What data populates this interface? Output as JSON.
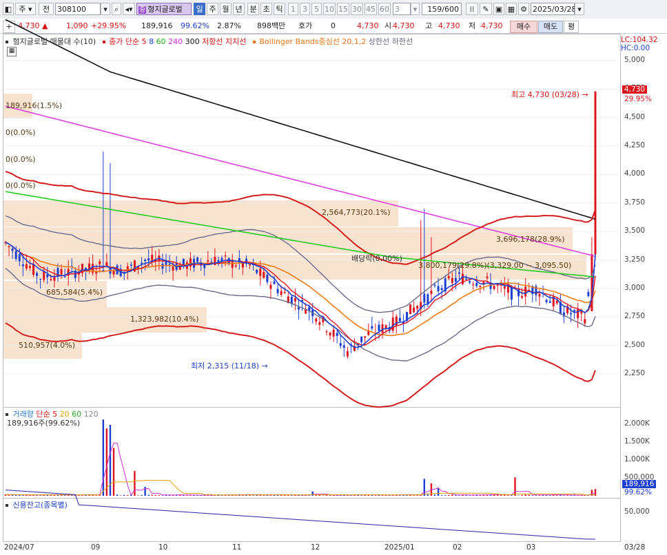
{
  "toolbar": {
    "type_label": "주",
    "range_label": "전",
    "code": "308100",
    "stock_name": "형지글로벌",
    "periods": [
      "일",
      "주",
      "월",
      "년",
      "분",
      "초",
      "틱"
    ],
    "nums": [
      "1",
      "3",
      "5",
      "10",
      "15",
      "30",
      "45",
      "60"
    ],
    "num_select": "3",
    "count": "159",
    "count_total": "/600",
    "date": "2025/03/28"
  },
  "quote": {
    "price": "4,730",
    "change": "1,090",
    "change_pct": "+29.95%",
    "volume": "189,916",
    "vol_ratio": "99.62%",
    "turnover": "2.87%",
    "amount": "898백만",
    "hoga_label": "호가",
    "hoga_val": "0",
    "hoga_price": "4,730",
    "open_label": "시",
    "open": "4,730",
    "high_label": "고",
    "high": "4,730",
    "low_label": "저",
    "low": "4,730",
    "buy": "매수",
    "sell": "매도",
    "eval": "평"
  },
  "legend": {
    "name": "형지글로벌 매물대 수(10)",
    "ma_label": "종가 단순 5",
    "ma8": "8",
    "ma60": "60",
    "ma240": "240",
    "ma300": "300",
    "resist": "저항선",
    "support": "지지선",
    "bb": "Bollinger Bands중심선 20,1,2",
    "bb_up": "상한선",
    "bb_down": "하한선"
  },
  "price_axis": {
    "lc": "LC:104.32",
    "hc": "HC:0.00",
    "ticks": [
      "5,000",
      "4,750",
      "4,500",
      "4,250",
      "4,000",
      "3,750",
      "3,500",
      "3,250",
      "3,000",
      "2,750",
      "2,500",
      "2,250"
    ],
    "last_price": "4,730",
    "last_pct": "29.95%"
  },
  "annotations": {
    "high": "최고 4,730 (03/28)",
    "low": "최저 2,315 (11/18)",
    "dividend": "배당락(0.00%)",
    "vp": [
      "189,916(1.5%)",
      "0(0.0%)",
      "0(0.0%)",
      "0(0.0%)",
      "2,564,773(20.1%)",
      "3,696,178(28.9%)",
      "3,800,179(29.8%)(3,329.00 ~ 3,095.50)",
      "685,584(5.4%)",
      "1,323,982(10.4%)",
      "510,957(4.0%)"
    ]
  },
  "volume_panel": {
    "label": "거래량",
    "ma_label": "단순 5",
    "ma20": "20",
    "ma60": "60",
    "ma120": "120",
    "current": "189,916주(99.62%)",
    "ticks": [
      "2,000K",
      "1,500K",
      "1,000K",
      "500,000"
    ],
    "last": "189,916",
    "last_pct": "99.62%"
  },
  "credit_panel": {
    "label": "신용잔고(종목별)",
    "ticks": [
      "50,000"
    ]
  },
  "x_axis": [
    "2024/07",
    "09",
    "10",
    "11",
    "12",
    "2025/01",
    "02",
    "03",
    "03/28"
  ],
  "colors": {
    "up": "#e0141e",
    "down": "#1b3fd0",
    "ma5": "#1b3fd0",
    "ma8": "#e0141e",
    "ma60": "#22cc22",
    "ma240": "#e040e0",
    "ma300": "#111111",
    "bb": "#6a6a8a",
    "bb_mid": "#f07a10",
    "envelope": "#d41c1c",
    "vp": "#f7e3cf"
  }
}
